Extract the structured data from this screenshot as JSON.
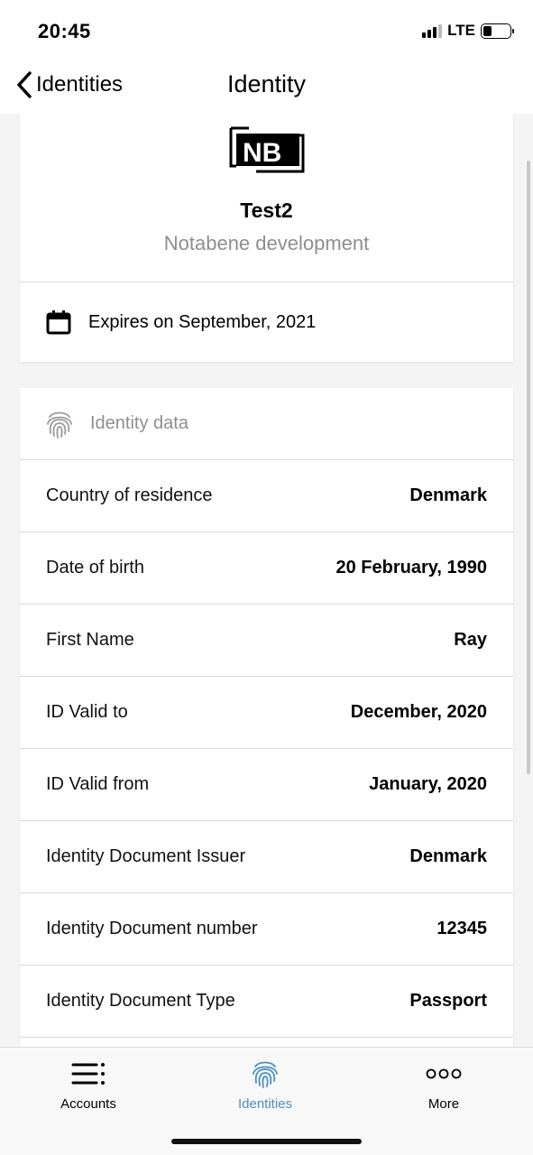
{
  "status_bar": {
    "time": "20:45",
    "network": "LTE",
    "battery_level": 0.3
  },
  "nav": {
    "back_label": "Identities",
    "title": "Identity"
  },
  "identity_card": {
    "logo_text": "NB",
    "name": "Test2",
    "organization": "Notabene development",
    "expiry_text": "Expires on September, 2021",
    "expiry_icon": "calendar-icon"
  },
  "identity_data": {
    "header_label": "Identity data",
    "header_icon": "fingerprint-icon",
    "rows": [
      {
        "label": "Country of residence",
        "value": "Denmark"
      },
      {
        "label": "Date of birth",
        "value": "20 February, 1990"
      },
      {
        "label": "First Name",
        "value": "Ray"
      },
      {
        "label": "ID Valid to",
        "value": "December, 2020"
      },
      {
        "label": "ID Valid from",
        "value": "January, 2020"
      },
      {
        "label": "Identity Document Issuer",
        "value": "Denmark"
      },
      {
        "label": "Identity Document number",
        "value": "12345"
      },
      {
        "label": "Identity Document Type",
        "value": "Passport"
      }
    ]
  },
  "tab_bar": {
    "active_tab": "Identities",
    "accent_color": "#4a8fc2",
    "tabs": [
      {
        "label": "Accounts",
        "icon": "list-icon"
      },
      {
        "label": "Identities",
        "icon": "fingerprint-icon"
      },
      {
        "label": "More",
        "icon": "more-icon"
      }
    ]
  }
}
